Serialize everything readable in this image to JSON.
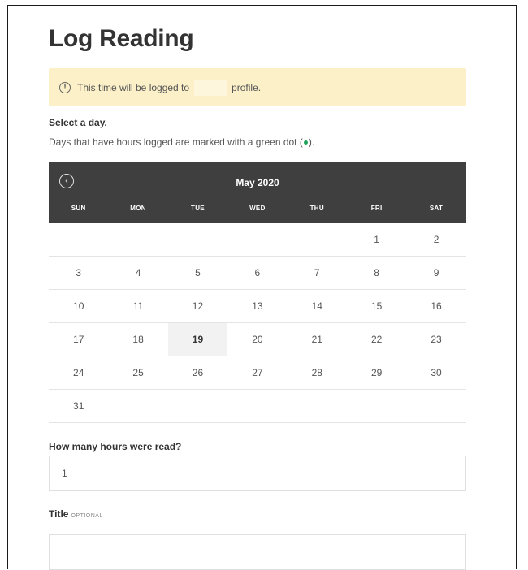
{
  "page": {
    "title": "Log Reading"
  },
  "notice": {
    "icon": "info-circle-icon",
    "text_before": "This time will be logged to",
    "text_after": "profile."
  },
  "day_select": {
    "label": "Select a day.",
    "hint_before": "Days that have hours logged are marked with a green dot (",
    "hint_after": ").",
    "dot_color": "#1fa35a"
  },
  "calendar": {
    "month": "May 2020",
    "prev_icon": "chevron-left-circle-icon",
    "header_color": "#3f3f3f",
    "weekdays": [
      "SUN",
      "MON",
      "TUE",
      "WED",
      "THU",
      "FRI",
      "SAT"
    ],
    "weeks": [
      [
        "",
        "",
        "",
        "",
        "",
        "1",
        "2"
      ],
      [
        "3",
        "4",
        "5",
        "6",
        "7",
        "8",
        "9"
      ],
      [
        "10",
        "11",
        "12",
        "13",
        "14",
        "15",
        "16"
      ],
      [
        "17",
        "18",
        "19",
        "20",
        "21",
        "22",
        "23"
      ],
      [
        "24",
        "25",
        "26",
        "27",
        "28",
        "29",
        "30"
      ],
      [
        "31",
        "",
        "",
        "",
        "",
        "",
        ""
      ]
    ],
    "selected_day": "19"
  },
  "hours": {
    "label": "How many hours were read?",
    "value": "1"
  },
  "title_field": {
    "label": "Title",
    "optional": "OPTIONAL",
    "value": ""
  },
  "colors": {
    "notice_bg": "#fbf0c8",
    "selected_bg": "#f2f2f2"
  }
}
